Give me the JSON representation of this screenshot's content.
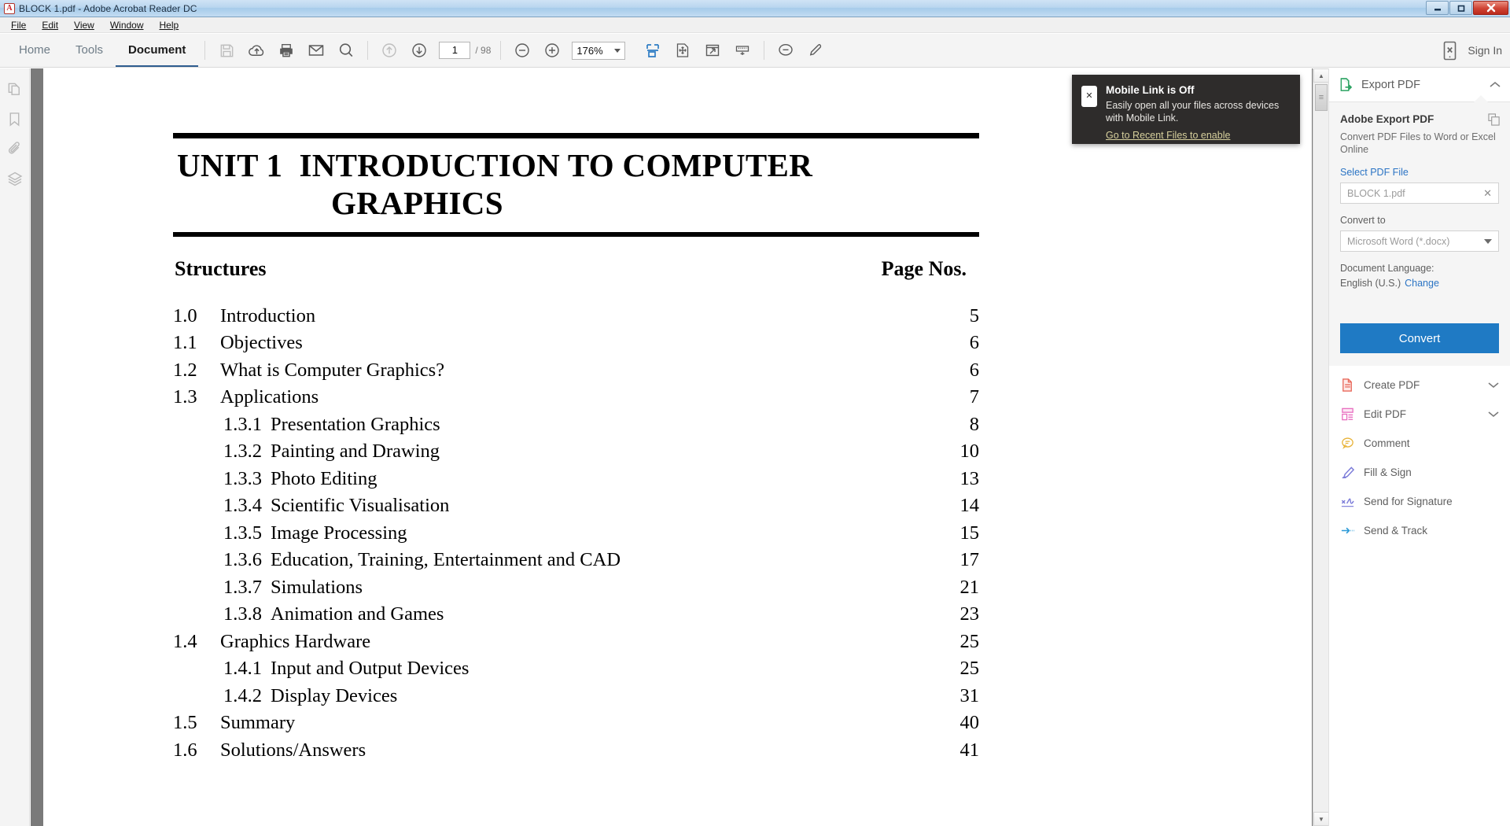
{
  "window": {
    "title": "BLOCK 1.pdf - Adobe Acrobat Reader DC",
    "app_icon": "acrobat-icon",
    "minimize": "–",
    "restore": "❐",
    "close": "✕"
  },
  "menubar": [
    {
      "label": "File",
      "accel": "F"
    },
    {
      "label": "Edit",
      "accel": "E"
    },
    {
      "label": "View",
      "accel": "V"
    },
    {
      "label": "Window",
      "accel": "W"
    },
    {
      "label": "Help",
      "accel": "H"
    }
  ],
  "toolbar": {
    "tabs": [
      {
        "label": "Home",
        "active": false
      },
      {
        "label": "Tools",
        "active": false
      },
      {
        "label": "Document",
        "active": true
      }
    ],
    "icons": [
      "save-icon",
      "upload-cloud-icon",
      "print-icon",
      "email-icon",
      "search-icon"
    ],
    "nav": {
      "previous_page_icon": "arrow-up-circle-icon",
      "next_page_icon": "arrow-down-circle-icon",
      "page_number": "1",
      "page_total": "/ 98"
    },
    "zoom": {
      "out_icon": "zoom-out-icon",
      "in_icon": "zoom-in-icon",
      "level": "176%",
      "dropdown_icon": "chevron-down-icon"
    },
    "view_icons": [
      "fit-page-icon",
      "pan-zoom-icon",
      "fullscreen-icon",
      "scroll-mode-icon"
    ],
    "annotate_icons": [
      "comment-icon",
      "highlight-pen-icon"
    ],
    "signin": {
      "icon": "mobile-device-icon",
      "label": "Sign In"
    }
  },
  "left_rail": [
    {
      "name": "page-thumbnails-icon"
    },
    {
      "name": "bookmarks-icon"
    },
    {
      "name": "attachments-icon"
    },
    {
      "name": "layers-icon"
    }
  ],
  "popup": {
    "icon": "mobile-device-icon",
    "title": "Mobile Link is Off",
    "body": "Easily open all your files across devices with Mobile Link.",
    "link": "Go to Recent Files to enable"
  },
  "document": {
    "unit_label": "UNIT 1",
    "title_line1": "INTRODUCTION TO COMPUTER",
    "title_line2": "GRAPHICS",
    "structures_header": "Structures",
    "pagenos_header": "Page Nos.",
    "toc": [
      {
        "num": "1.0",
        "label": "Introduction",
        "page": "5",
        "sub": false
      },
      {
        "num": "1.1",
        "label": "Objectives",
        "page": "6",
        "sub": false
      },
      {
        "num": "1.2",
        "label": "What is Computer Graphics?",
        "page": "6",
        "sub": false
      },
      {
        "num": "1.3",
        "label": "Applications",
        "page": "7",
        "sub": false
      },
      {
        "num": "1.3.1",
        "label": "Presentation Graphics",
        "page": "8",
        "sub": true
      },
      {
        "num": "1.3.2",
        "label": "Painting and Drawing",
        "page": "10",
        "sub": true
      },
      {
        "num": "1.3.3",
        "label": "Photo Editing",
        "page": "13",
        "sub": true
      },
      {
        "num": "1.3.4",
        "label": "Scientific Visualisation",
        "page": "14",
        "sub": true
      },
      {
        "num": "1.3.5",
        "label": "Image Processing",
        "page": "15",
        "sub": true
      },
      {
        "num": "1.3.6",
        "label": "Education, Training, Entertainment and CAD",
        "page": "17",
        "sub": true
      },
      {
        "num": "1.3.7",
        "label": "Simulations",
        "page": "21",
        "sub": true
      },
      {
        "num": "1.3.8",
        "label": "Animation and Games",
        "page": "23",
        "sub": true
      },
      {
        "num": "1.4",
        "label": "Graphics Hardware",
        "page": "25",
        "sub": false
      },
      {
        "num": "1.4.1",
        "label": "Input and Output Devices",
        "page": "25",
        "sub": true
      },
      {
        "num": "1.4.2",
        "label": "Display Devices",
        "page": "31",
        "sub": true
      },
      {
        "num": "1.5",
        "label": "Summary",
        "page": "40",
        "sub": false
      },
      {
        "num": "1.6",
        "label": "Solutions/Answers",
        "page": "41",
        "sub": false
      }
    ]
  },
  "right_panel": {
    "header": {
      "icon": "export-pdf-icon",
      "label": "Export PDF",
      "collapse_icon": "chevron-up-icon"
    },
    "export": {
      "title": "Adobe Export PDF",
      "subtitle": "Convert PDF Files to Word or Excel Online",
      "copy_icon": "copy-files-icon",
      "select_label": "Select PDF File",
      "file_value": "BLOCK 1.pdf",
      "clear_icon": "close-icon",
      "convert_to_label": "Convert to",
      "format_value": "Microsoft Word (*.docx)",
      "language_label": "Document Language:",
      "language_value": "English (U.S.)",
      "language_change": "Change",
      "convert_button": "Convert"
    },
    "tools": [
      {
        "label": "Create PDF",
        "icon": "create-pdf-icon",
        "expandable": true
      },
      {
        "label": "Edit PDF",
        "icon": "edit-pdf-icon",
        "expandable": true
      },
      {
        "label": "Comment",
        "icon": "comment-icon",
        "expandable": false
      },
      {
        "label": "Fill & Sign",
        "icon": "fill-sign-icon",
        "expandable": false
      },
      {
        "label": "Send for Signature",
        "icon": "send-signature-icon",
        "expandable": false
      },
      {
        "label": "Send & Track",
        "icon": "send-track-icon",
        "expandable": false
      }
    ]
  },
  "colors": {
    "accent_blue": "#1f7ac4",
    "link_blue": "#2b74c4",
    "tool_blue": "#2e7cc4",
    "popup_bg": "#2e2c2b",
    "popup_link": "#d6cf9c"
  }
}
